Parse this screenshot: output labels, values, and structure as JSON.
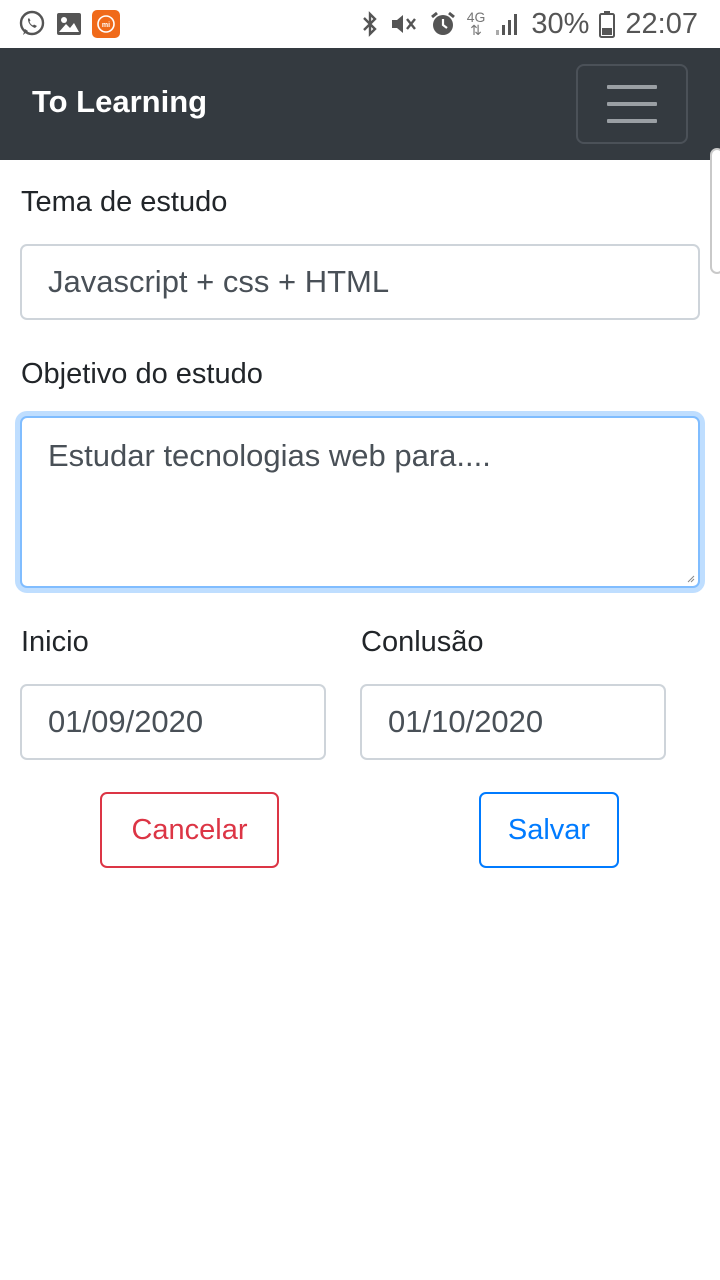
{
  "status_bar": {
    "icons_left": [
      "whatsapp-icon",
      "gallery-icon",
      "mi-icon"
    ],
    "icons_right": [
      "bluetooth-icon",
      "mute-vibrate-icon",
      "alarm-icon",
      "network-4g-icon",
      "signal-icon"
    ],
    "network_type": "4G",
    "battery": "30%",
    "time": "22:07"
  },
  "navbar": {
    "brand": "To Learning",
    "background": "#343a40"
  },
  "form": {
    "tema_label": "Tema de estudo",
    "tema_value": "Javascript + css + HTML",
    "objetivo_label": "Objetivo do estudo",
    "objetivo_placeholder": "Estudar tecnologias web para....",
    "inicio_label": "Inicio",
    "inicio_value": "01/09/2020",
    "conclusao_label": "Conlusão",
    "conclusao_value": "01/10/2020"
  },
  "buttons": {
    "cancel_label": "Cancelar",
    "save_label": "Salvar"
  },
  "colors": {
    "danger": "#dc3545",
    "primary": "#007bff",
    "focus_border": "#80bdff"
  }
}
